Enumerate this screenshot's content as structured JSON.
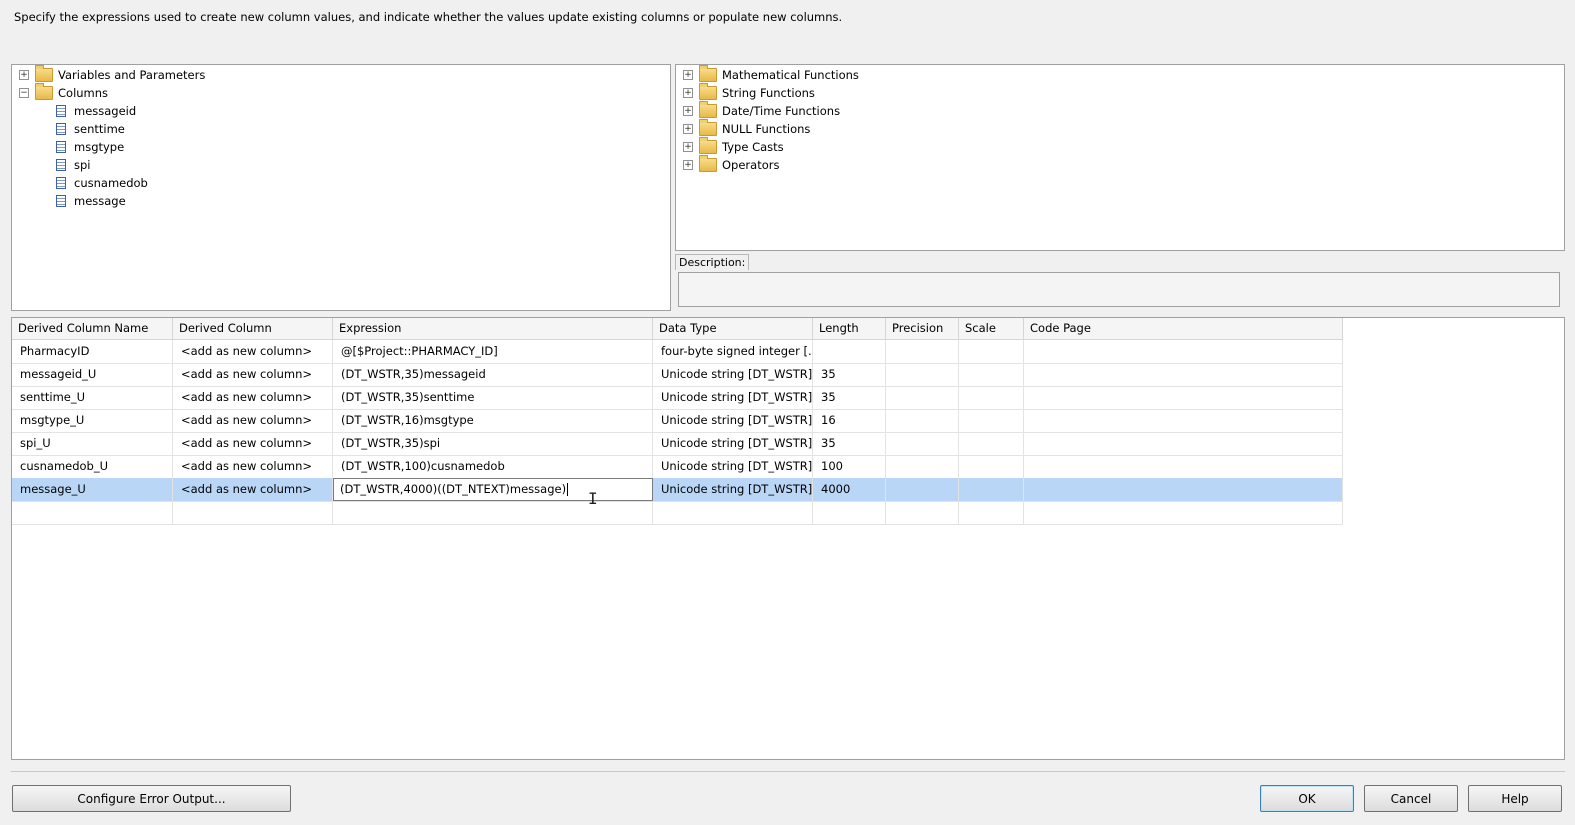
{
  "instructions": "Specify the expressions used to create new column values, and indicate whether the values update existing columns or populate new columns.",
  "left_tree": {
    "nodes": [
      {
        "label": "Variables and Parameters",
        "expander": "+"
      },
      {
        "label": "Columns",
        "expander": "−"
      }
    ],
    "columns": [
      "messageid",
      "senttime",
      "msgtype",
      "spi",
      "cusnamedob",
      "message"
    ]
  },
  "right_tree": {
    "nodes": [
      {
        "label": "Mathematical Functions",
        "expander": "+"
      },
      {
        "label": "String Functions",
        "expander": "+"
      },
      {
        "label": "Date/Time Functions",
        "expander": "+"
      },
      {
        "label": "NULL Functions",
        "expander": "+"
      },
      {
        "label": "Type Casts",
        "expander": "+"
      },
      {
        "label": "Operators",
        "expander": "+"
      }
    ]
  },
  "description": {
    "label": "Description:",
    "text": ""
  },
  "grid": {
    "headers": [
      "Derived Column Name",
      "Derived Column",
      "Expression",
      "Data Type",
      "Length",
      "Precision",
      "Scale",
      "Code Page"
    ],
    "rows": [
      [
        "PharmacyID",
        "<add as new column>",
        "@[$Project::PHARMACY_ID]",
        "four-byte signed integer [...",
        "",
        "",
        "",
        ""
      ],
      [
        "messageid_U",
        "<add as new column>",
        "(DT_WSTR,35)messageid",
        "Unicode string [DT_WSTR]",
        "35",
        "",
        "",
        ""
      ],
      [
        "senttime_U",
        "<add as new column>",
        "(DT_WSTR,35)senttime",
        "Unicode string [DT_WSTR]",
        "35",
        "",
        "",
        ""
      ],
      [
        "msgtype_U",
        "<add as new column>",
        "(DT_WSTR,16)msgtype",
        "Unicode string [DT_WSTR]",
        "16",
        "",
        "",
        ""
      ],
      [
        "spi_U",
        "<add as new column>",
        "(DT_WSTR,35)spi",
        "Unicode string [DT_WSTR]",
        "35",
        "",
        "",
        ""
      ],
      [
        "cusnamedob_U",
        "<add as new column>",
        "(DT_WSTR,100)cusnamedob",
        "Unicode string [DT_WSTR]",
        "100",
        "",
        "",
        ""
      ],
      [
        "message_U",
        "<add as new column>",
        "(DT_WSTR,4000)((DT_NTEXT)message)",
        "Unicode string [DT_WSTR]",
        "4000",
        "",
        "",
        ""
      ]
    ],
    "selected_row": 6
  },
  "buttons": {
    "configure_error_output": "Configure Error Output...",
    "ok": "OK",
    "cancel": "Cancel",
    "help": "Help"
  },
  "colors": {
    "selection": "#b9d6f7",
    "background": "#f0f0f0"
  }
}
